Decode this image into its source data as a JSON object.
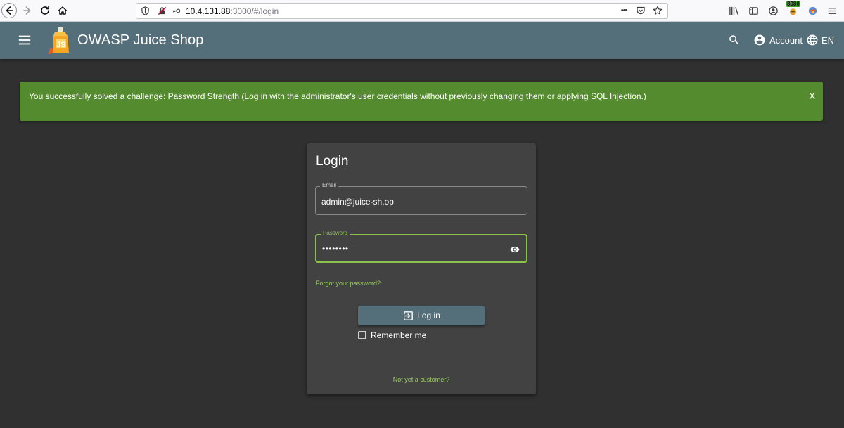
{
  "browser": {
    "url_host": "10.4.131.88",
    "url_path": ":3000/#/login",
    "more_label": "•••",
    "addon_badge": "8080"
  },
  "app": {
    "title": "OWASP Juice Shop",
    "account_label": "Account",
    "language_label": "EN",
    "brand_color": "#546e7a"
  },
  "banner": {
    "text": "You successfully solved a challenge: Password Strength (Log in with the administrator's user credentials without previously changing them or applying SQL Injection.)",
    "close_label": "X",
    "color": "#558b2f"
  },
  "login": {
    "title": "Login",
    "email_label": "Email",
    "email_value": "admin@juice-sh.op",
    "password_label": "Password",
    "password_value": "••••••••",
    "forgot_label": "Forgot your password?",
    "login_button_label": "Log in",
    "remember_label": "Remember me",
    "register_label": "Not yet a customer?"
  }
}
